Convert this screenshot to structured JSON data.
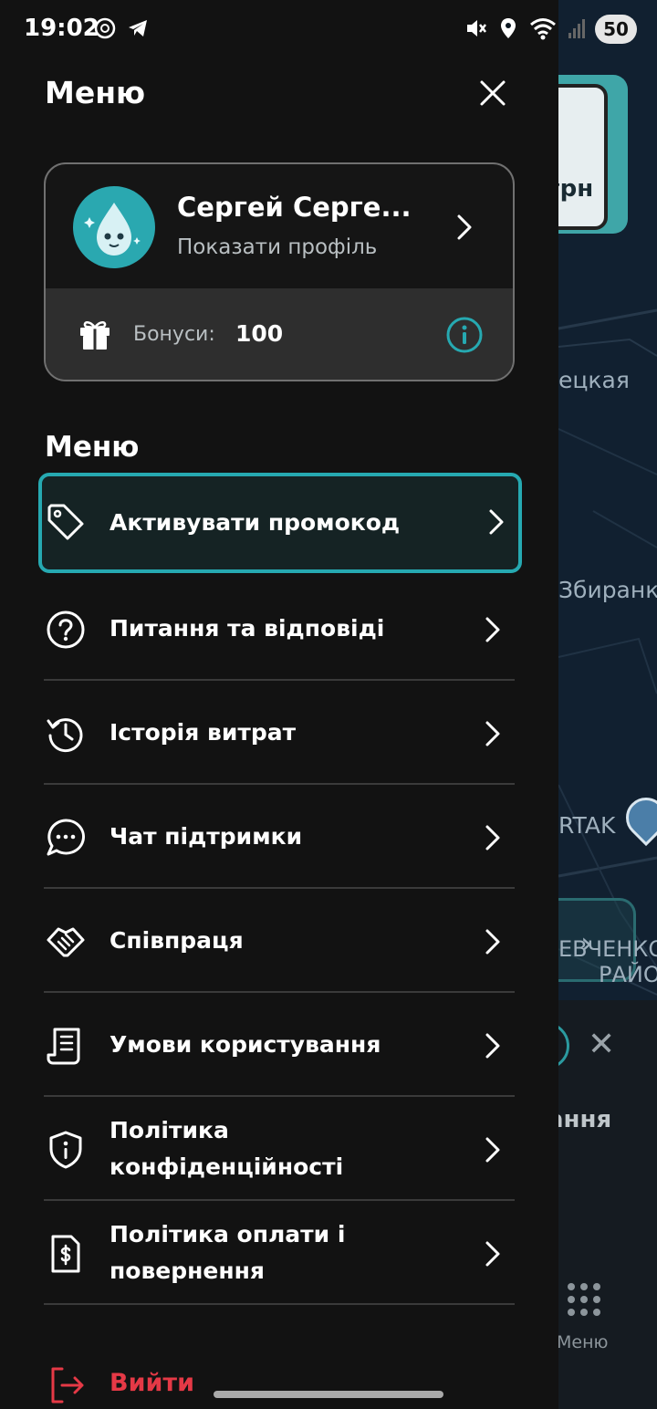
{
  "status_bar": {
    "time": "19:02",
    "battery": "50",
    "left_icons": [
      "chatgpt-icon",
      "telegram-icon"
    ],
    "right_icons": [
      "mute-vibrate-icon",
      "location-icon",
      "wifi-icon",
      "signal-icon",
      "signal-roaming-icon"
    ]
  },
  "drawer": {
    "title": "Меню",
    "profile": {
      "name": "Сергей Серге...",
      "subtitle": "Показати профіль",
      "bonus_label": "Бонуси:",
      "bonus_value": "100"
    },
    "section_title": "Меню",
    "items": [
      {
        "label": "Активувати промокод",
        "icon": "tag-icon",
        "active": true
      },
      {
        "label": "Питання та відповіді",
        "icon": "question-circle-icon"
      },
      {
        "label": "Історія витрат",
        "icon": "history-icon"
      },
      {
        "label": "Чат підтримки",
        "icon": "chat-bubble-icon"
      },
      {
        "label": "Співпраця",
        "icon": "handshake-icon"
      },
      {
        "label": "Умови користування",
        "icon": "document-icon"
      },
      {
        "label": "Політика конфіденційності",
        "icon": "shield-info-icon"
      },
      {
        "label": "Політика оплати і повернення",
        "icon": "invoice-dollar-icon"
      }
    ],
    "logout_label": "Вийти"
  },
  "background": {
    "map_labels": [
      "ецкая",
      "Збиранк",
      "RTAK",
      "ЕВЧЕНКО",
      "РАЙО"
    ],
    "promo_price": "грн",
    "sheet_title": "ання",
    "sheet_menu_label": "Меню"
  },
  "colors": {
    "accent": "#26a9b1",
    "logout": "#e53946",
    "drawer_bg": "#121212"
  }
}
